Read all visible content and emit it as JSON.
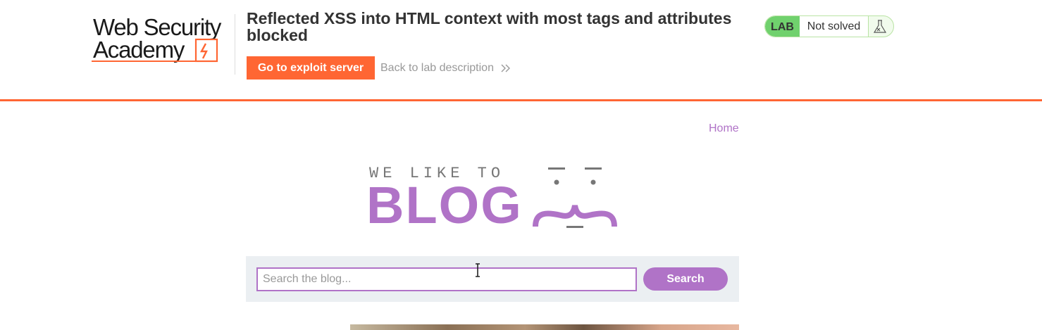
{
  "header": {
    "logo_text": [
      "Web Security",
      "Academy"
    ],
    "lab_title": "Reflected XSS into HTML context with most tags and attributes blocked",
    "exploit_button": "Go to exploit server",
    "back_link": "Back to lab description",
    "lab_badge": "LAB",
    "lab_status": "Not solved"
  },
  "nav": {
    "home": "Home"
  },
  "banner": {
    "tagline": "WE LIKE TO",
    "word": "BLOG"
  },
  "search": {
    "placeholder": "Search the blog...",
    "value": "",
    "button": "Search"
  },
  "colors": {
    "accent_orange": "#ff6633",
    "accent_purple": "#b073c7",
    "status_green": "#70d16d",
    "panel_grey": "#ebeff2"
  },
  "icons": [
    "chevron-double-right-icon",
    "flask-icon",
    "academy-bolt-logo"
  ]
}
